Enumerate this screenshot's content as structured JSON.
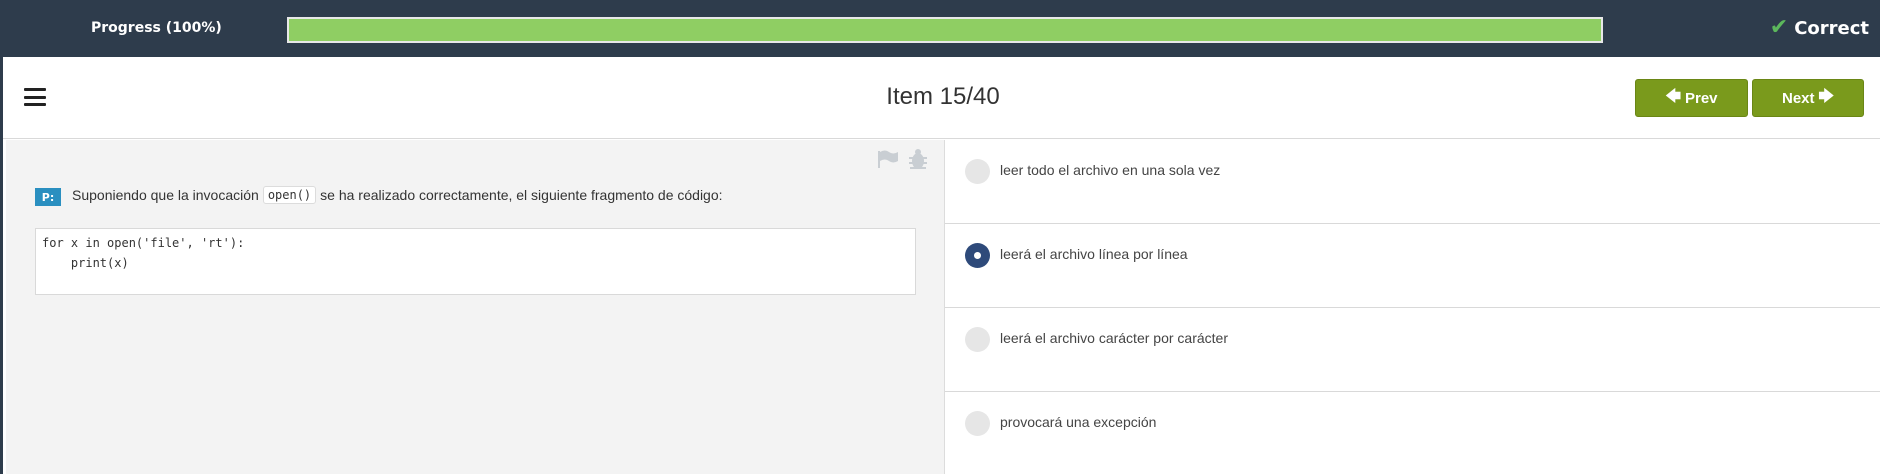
{
  "progress": {
    "label": "Progress (100%)",
    "value_percent": 100,
    "fill_color": "#8fce63"
  },
  "status": {
    "label": "Correct",
    "icon": "check-icon"
  },
  "header": {
    "menu_icon": "hamburger-menu-icon",
    "title": "Item 15/40",
    "prev_label": "Prev",
    "next_label": "Next",
    "button_color": "#7a9a1c"
  },
  "question": {
    "badge": "P:",
    "text_before": "Suponiendo que la invocación",
    "inline_code": "open()",
    "text_after": "se ha realizado correctamente, el siguiente fragmento de código:",
    "code": "for x in open('file', 'rt'):\n    print(x)",
    "flag_icon": "flag-icon",
    "bug_icon": "bug-icon"
  },
  "answers": [
    {
      "label": "leer todo el archivo en una sola vez",
      "selected": false
    },
    {
      "label": "leerá el archivo línea por línea",
      "selected": true
    },
    {
      "label": "leerá el archivo carácter por carácter",
      "selected": false
    },
    {
      "label": "provocará una excepción",
      "selected": false
    }
  ],
  "colors": {
    "topbar": "#2e3c4c",
    "selected_radio": "#2e4a7a",
    "badge": "#2a8fc0"
  }
}
